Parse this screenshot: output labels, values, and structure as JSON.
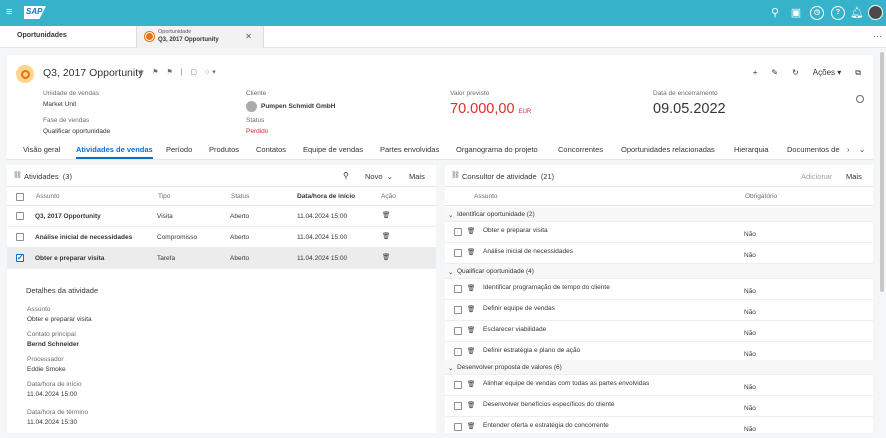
{
  "shell": {
    "logo": "SAP",
    "icons": [
      "search-icon",
      "feedback-icon",
      "history-icon",
      "help-icon",
      "notification-icon",
      "avatar"
    ]
  },
  "tabs": {
    "tab1": "Oportunidades",
    "tab2_line1": "Oportunidade",
    "tab2_line2": "Q3, 2017 Opportunity"
  },
  "header": {
    "title": "Q3, 2017 Opportunity",
    "actions_label": "Ações",
    "fields": {
      "unit_label": "Unidade de vendas",
      "unit_value": "Market Unit",
      "phase_label": "Fase de vendas",
      "phase_value": "Qualificar oportunidade",
      "client_label": "Cliente",
      "client_value": "Pumpen Schmidt GmbH",
      "status_label": "Status",
      "status_value": "Perdido",
      "expected_label": "Valor previsto",
      "expected_value": "70.000,00",
      "expected_currency": "EUR",
      "close_label": "Data de encerramento",
      "close_value": "09.05.2022"
    }
  },
  "nav": [
    "Visão geral",
    "Atividades de vendas",
    "Período",
    "Produtos",
    "Contatos",
    "Equipe de vendas",
    "Partes envolvidas",
    "Organograma do projeto",
    "Concorrentes",
    "Oportunidades relacionadas",
    "Hierarquia",
    "Documentos de"
  ],
  "activities": {
    "title": "Atividades",
    "count": "(3)",
    "novo": "Novo",
    "mais": "Mais",
    "columns": [
      "Assunto",
      "Tipo",
      "Status",
      "Data/hora de início",
      "Ação"
    ],
    "rows": [
      [
        "Q3, 2017 Opportunity",
        "Visita",
        "Aberto",
        "11.04.2024 15:00"
      ],
      [
        "Análise inicial de necessidades",
        "Compromisso",
        "Aberto",
        "11.04.2024 15:00"
      ],
      [
        "Obter e preparar visita",
        "Tarefa",
        "Aberto",
        "11.04.2024 15:00"
      ]
    ],
    "details": {
      "title": "Detalhes da atividade",
      "subject_label": "Assunto",
      "subject_value": "Obter e preparar visita",
      "contact_label": "Contato principal",
      "contact_value": "Bernd Schneider",
      "processor_label": "Processador",
      "processor_value": "Eddie Smoke",
      "start_label": "Data/hora de início",
      "start_value": "11.04.2024 15:00",
      "end_label": "Data/hora de término",
      "end_value": "11.04.2024 15:30"
    }
  },
  "advisor": {
    "title": "Consultor de atividade",
    "count": "(21)",
    "add": "Adicionar",
    "mais": "Mais",
    "col_subject": "Assunto",
    "col_required": "Obrigatório",
    "groups": [
      {
        "label": "Identificar oportunidade (2)",
        "items": [
          "Obter e preparar visita",
          "Análise inicial de necessidades"
        ]
      },
      {
        "label": "Qualificar oportunidade (4)",
        "items": [
          "Identificar programação de tempo do cliente",
          "Definir equipe de vendas",
          "Esclarecer viabilidade",
          "Definir estratégia e plano de ação"
        ]
      },
      {
        "label": "Desenvolver proposta de valores (6)",
        "items": [
          "Alinhar equipe de vendas com todas as partes envolvidas",
          "Desenvolver benefícios específicos do cliente",
          "Entender oferta e estratégia do concorrente"
        ]
      }
    ],
    "no": "Não"
  },
  "colors": {
    "shell": "#36b3cb",
    "accent": "#0a6ed1",
    "negative": "#e02b2b"
  }
}
